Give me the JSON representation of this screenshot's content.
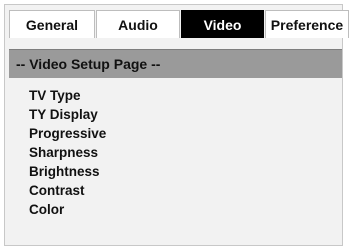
{
  "tabs": [
    {
      "label": "General",
      "active": false
    },
    {
      "label": "Audio",
      "active": false
    },
    {
      "label": "Video",
      "active": true
    },
    {
      "label": "Preference",
      "active": false
    }
  ],
  "page": {
    "header": "-- Video Setup Page --"
  },
  "menu": {
    "items": [
      {
        "label": "TV Type"
      },
      {
        "label": "TY Display"
      },
      {
        "label": "Progressive"
      },
      {
        "label": "Sharpness"
      },
      {
        "label": "Brightness"
      },
      {
        "label": "Contrast"
      },
      {
        "label": "Color"
      }
    ]
  },
  "colors": {
    "active_tab_bg": "#000000",
    "active_tab_text": "#ffffff",
    "header_bar_bg": "#9a9a9a",
    "panel_bg": "#f2f2f2"
  }
}
